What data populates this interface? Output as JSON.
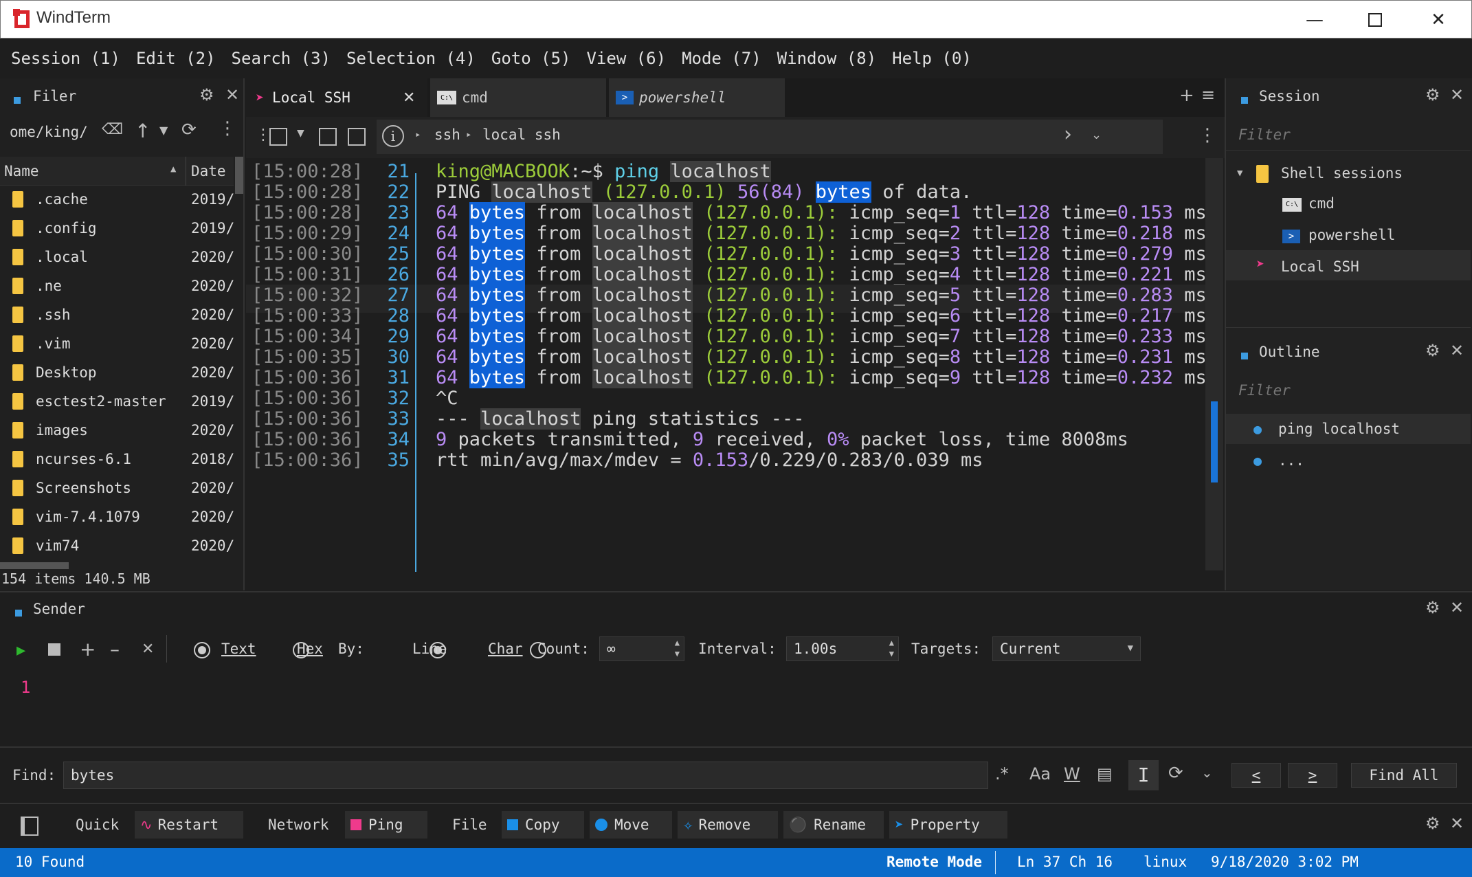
{
  "app": {
    "title": "WindTerm"
  },
  "menu": [
    "Session (1)",
    "Edit (2)",
    "Search (3)",
    "Selection (4)",
    "Goto (5)",
    "View (6)",
    "Mode (7)",
    "Window (8)",
    "Help (0)"
  ],
  "filer": {
    "title": "Filer",
    "path": "ome/king/",
    "col_name": "Name",
    "col_date": "Date",
    "items": [
      {
        "name": ".cache",
        "date": "2019/"
      },
      {
        "name": ".config",
        "date": "2019/"
      },
      {
        "name": ".local",
        "date": "2020/"
      },
      {
        "name": ".ne",
        "date": "2020/"
      },
      {
        "name": ".ssh",
        "date": "2020/"
      },
      {
        "name": ".vim",
        "date": "2020/"
      },
      {
        "name": "Desktop",
        "date": "2020/"
      },
      {
        "name": "esctest2-master",
        "date": "2019/"
      },
      {
        "name": "images",
        "date": "2020/"
      },
      {
        "name": "ncurses-6.1",
        "date": "2018/"
      },
      {
        "name": "Screenshots",
        "date": "2020/"
      },
      {
        "name": "vim-7.4.1079",
        "date": "2020/"
      },
      {
        "name": "vim74",
        "date": "2020/"
      }
    ],
    "footer": "154 items 140.5 MB"
  },
  "tabs": [
    {
      "label": "Local SSH",
      "active": true
    },
    {
      "label": "cmd",
      "active": false
    },
    {
      "label": "powershell",
      "active": false
    }
  ],
  "breadcrumb": [
    "ssh",
    "local ssh"
  ],
  "terminal": {
    "timestamps": [
      "[15:00:28]",
      "[15:00:28]",
      "[15:00:28]",
      "[15:00:29]",
      "[15:00:30]",
      "[15:00:31]",
      "[15:00:32]",
      "[15:00:33]",
      "[15:00:34]",
      "[15:00:35]",
      "[15:00:36]",
      "[15:00:36]",
      "[15:00:36]",
      "[15:00:36]",
      "[15:00:36]"
    ],
    "line_numbers": [
      "21",
      "22",
      "23",
      "24",
      "25",
      "26",
      "27",
      "28",
      "29",
      "30",
      "31",
      "32",
      "33",
      "34",
      "35"
    ],
    "prompt_user": "king@MACBOOK",
    "prompt_sep": ":~$",
    "cmd": "ping",
    "cmd_arg": "localhost",
    "ping_header": {
      "a": "PING",
      "b": "localhost",
      "c": "(127.0.0.1)",
      "d": "56(84)",
      "e": "bytes",
      "f": "of data."
    },
    "reply_parts": {
      "n": "64",
      "bytes": "bytes",
      "from": "from",
      "host": "localhost",
      "ip": "(127.0.0.1):",
      "seq": "icmp_seq=",
      "ttl": "ttl=",
      "ttlv": "128",
      "time": "time=",
      "ms": "ms"
    },
    "replies": [
      {
        "seq": "1",
        "time": "0.153"
      },
      {
        "seq": "2",
        "time": "0.218"
      },
      {
        "seq": "3",
        "time": "0.279"
      },
      {
        "seq": "4",
        "time": "0.221"
      },
      {
        "seq": "5",
        "time": "0.283"
      },
      {
        "seq": "6",
        "time": "0.217"
      },
      {
        "seq": "7",
        "time": "0.233"
      },
      {
        "seq": "8",
        "time": "0.231"
      },
      {
        "seq": "9",
        "time": "0.232"
      }
    ],
    "ctrl_c": "^C",
    "stats_header": {
      "a": "---",
      "b": "localhost",
      "c": "ping statistics ---"
    },
    "stats": {
      "a": "9",
      "b": " packets transmitted, ",
      "c": "9",
      "d": " received, ",
      "e": "0%",
      "f": " packet loss, time 8008ms"
    },
    "rtt": {
      "a": "rtt min/avg/max/mdev = ",
      "b": "0.153",
      "c": "/0.229/0.283/0.039 ms"
    }
  },
  "session_panel": {
    "title": "Session",
    "filter": "Filter",
    "group": "Shell sessions",
    "items": [
      "cmd",
      "powershell",
      "Local SSH"
    ]
  },
  "outline_panel": {
    "title": "Outline",
    "filter": "Filter",
    "items": [
      "ping localhost",
      "..."
    ]
  },
  "sender": {
    "title": "Sender",
    "text_label": "Text",
    "hex_label": "Hex",
    "by_label": "By:",
    "line_label": "Line",
    "char_label": "Char",
    "count_label": "Count:",
    "count_value": "∞",
    "interval_label": "Interval:",
    "interval_value": "1.00s",
    "targets_label": "Targets:",
    "targets_value": "Current",
    "editor_line": "1"
  },
  "find": {
    "label": "Find:",
    "value": "bytes",
    "regex": ".*",
    "case": "Aa",
    "word": "W",
    "prev": "<",
    "next": ">",
    "find_all": "Find All"
  },
  "quickbar": {
    "quick": "Quick",
    "restart": "Restart",
    "network": "Network",
    "ping": "Ping",
    "file": "File",
    "copy": "Copy",
    "move": "Move",
    "remove": "Remove",
    "rename": "Rename",
    "property": "Property"
  },
  "status": {
    "found": "10 Found",
    "mode": "Remote Mode",
    "position": "Ln 37 Ch 16",
    "os": "linux",
    "datetime": "9/18/2020 3:02 PM"
  }
}
